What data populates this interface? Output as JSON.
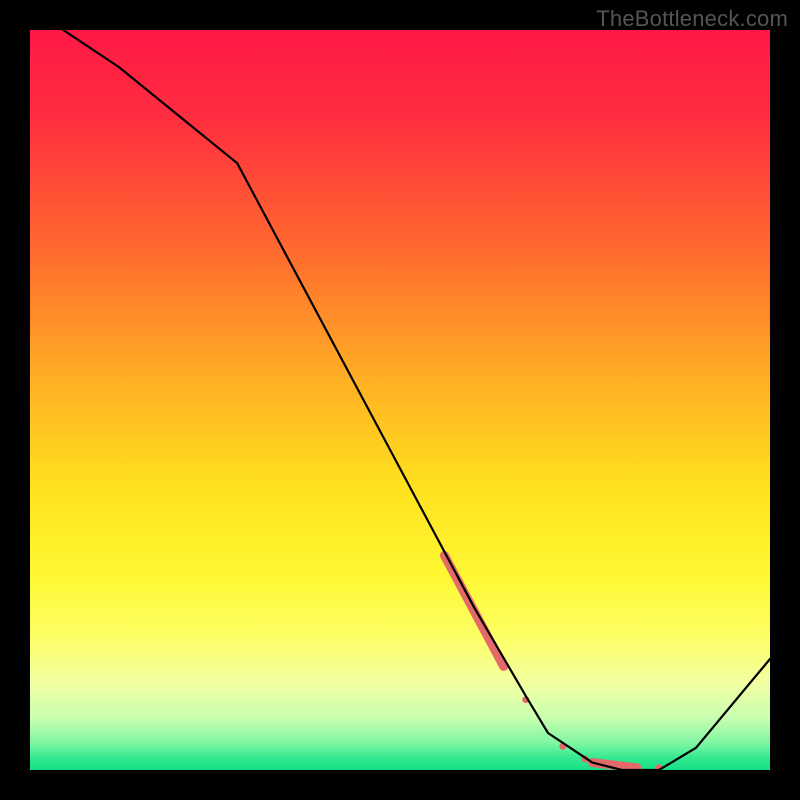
{
  "watermark": "TheBottleneck.com",
  "chart_data": {
    "type": "line",
    "title": "",
    "xlabel": "",
    "ylabel": "",
    "xlim": [
      0,
      100
    ],
    "ylim": [
      0,
      100
    ],
    "grid": false,
    "series": [
      {
        "name": "curve",
        "x": [
          0,
          12,
          28,
          60,
          67,
          70,
          76,
          80,
          85,
          90,
          100
        ],
        "values": [
          103,
          95,
          82,
          22,
          10,
          5,
          1,
          0,
          0,
          3,
          15
        ]
      }
    ],
    "markers": [
      {
        "name": "thick-segment",
        "x0": 56,
        "y0": 29,
        "x1": 64,
        "y1": 14,
        "width": 9,
        "color": "#e46a6a"
      },
      {
        "name": "dot-a",
        "x": 67,
        "y": 9.5,
        "r": 3.5,
        "color": "#e46a6a"
      },
      {
        "name": "dot-b",
        "x": 72,
        "y": 3.2,
        "r": 3.5,
        "color": "#e46a6a"
      },
      {
        "name": "dot-c",
        "x": 75,
        "y": 1.5,
        "r": 3.5,
        "color": "#e46a6a"
      },
      {
        "name": "thick-segment-2",
        "x0": 76,
        "y0": 1,
        "x1": 82,
        "y1": 0.3,
        "width": 9,
        "color": "#e46a6a"
      },
      {
        "name": "dot-d",
        "x": 85,
        "y": 0.3,
        "r": 3.5,
        "color": "#e46a6a"
      }
    ],
    "background_gradient": {
      "stops": [
        {
          "offset": 0.0,
          "color": "#ff1846"
        },
        {
          "offset": 0.12,
          "color": "#ff2e3f"
        },
        {
          "offset": 0.3,
          "color": "#ff6b2e"
        },
        {
          "offset": 0.48,
          "color": "#ffb224"
        },
        {
          "offset": 0.62,
          "color": "#ffe21e"
        },
        {
          "offset": 0.74,
          "color": "#fff833"
        },
        {
          "offset": 0.82,
          "color": "#fdff66"
        },
        {
          "offset": 0.88,
          "color": "#f3ffa0"
        },
        {
          "offset": 0.93,
          "color": "#c8ffb0"
        },
        {
          "offset": 0.965,
          "color": "#7af5a1"
        },
        {
          "offset": 0.985,
          "color": "#2fe88f"
        },
        {
          "offset": 1.0,
          "color": "#18df88"
        }
      ]
    }
  }
}
